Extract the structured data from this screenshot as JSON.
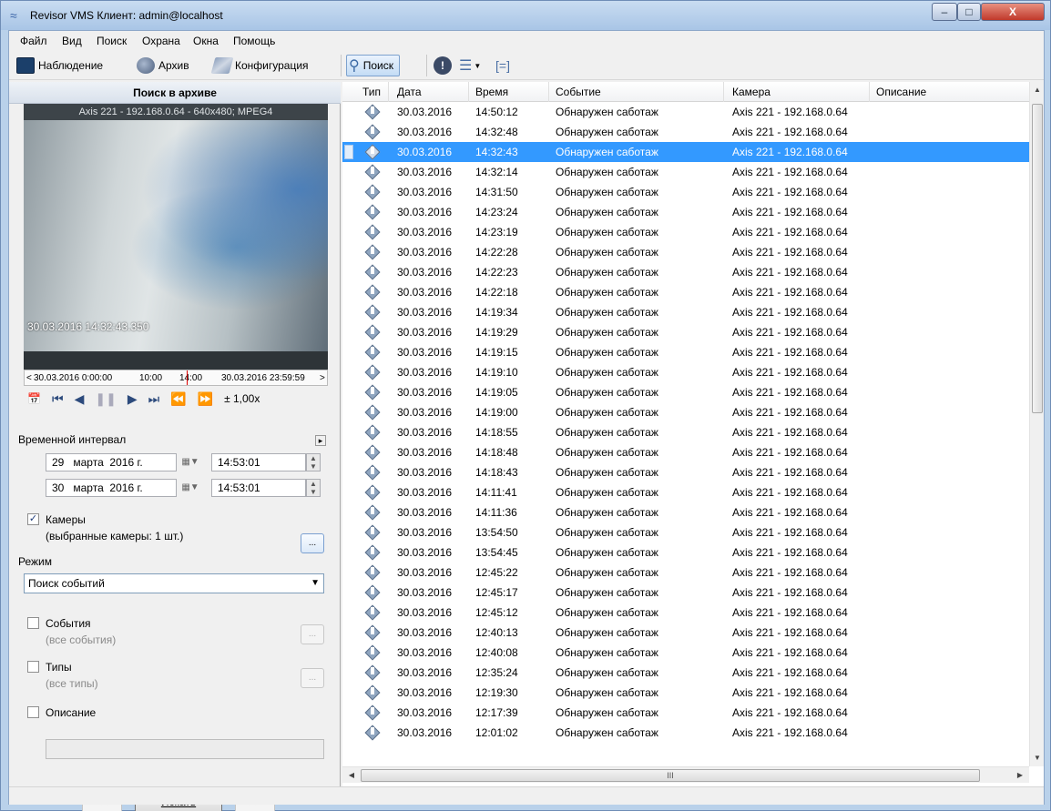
{
  "window": {
    "title": "Revisor VMS Клиент: admin@localhost",
    "buttons": {
      "minimize": "–",
      "maximize": "□",
      "close": "X"
    }
  },
  "menu": {
    "items": [
      "Файл",
      "Вид",
      "Поиск",
      "Охрана",
      "Окна",
      "Помощь"
    ]
  },
  "toolbar": {
    "observe": "Наблюдение",
    "archive": "Архив",
    "config": "Конфигурация",
    "search": "Поиск"
  },
  "left": {
    "header": "Поиск в архиве",
    "video_caption": "Axis 221 - 192.168.0.64 - 640x480; MPEG4",
    "video_timestamp": "30.03.2016 14:32:43.350",
    "timeline": {
      "start": "30.03.2016 0:00:00",
      "t1": "10:00",
      "t2": "14:00",
      "end": "30.03.2016 23:59:59"
    },
    "speed": "± 1,00x",
    "interval_label": "Временной интервал",
    "from": {
      "day": "29",
      "month": "марта",
      "year": "2016 г.",
      "time": "14:53:01"
    },
    "to": {
      "day": "30",
      "month": "марта",
      "year": "2016 г.",
      "time": "14:53:01"
    },
    "cameras_label": "Камеры",
    "cameras_sub": "(выбранные камеры: 1 шт.)",
    "mode_label": "Режим",
    "mode_value": "Поиск событий",
    "events_label": "События",
    "events_sub": "(все события)",
    "types_label": "Типы",
    "types_sub": "(все типы)",
    "desc_label": "Описание",
    "prev": "<<",
    "search": "Искать",
    "next": ">>"
  },
  "grid": {
    "headers": [
      "Тип",
      "Дата",
      "Время",
      "Событие",
      "Камера",
      "Описание"
    ],
    "selected_index": 2,
    "rows": [
      {
        "date": "30.03.2016",
        "time": "14:50:12",
        "event": "Обнаружен саботаж",
        "camera": "Axis 221 - 192.168.0.64"
      },
      {
        "date": "30.03.2016",
        "time": "14:32:48",
        "event": "Обнаружен саботаж",
        "camera": "Axis 221 - 192.168.0.64"
      },
      {
        "date": "30.03.2016",
        "time": "14:32:43",
        "event": "Обнаружен саботаж",
        "camera": "Axis 221 - 192.168.0.64"
      },
      {
        "date": "30.03.2016",
        "time": "14:32:14",
        "event": "Обнаружен саботаж",
        "camera": "Axis 221 - 192.168.0.64"
      },
      {
        "date": "30.03.2016",
        "time": "14:31:50",
        "event": "Обнаружен саботаж",
        "camera": "Axis 221 - 192.168.0.64"
      },
      {
        "date": "30.03.2016",
        "time": "14:23:24",
        "event": "Обнаружен саботаж",
        "camera": "Axis 221 - 192.168.0.64"
      },
      {
        "date": "30.03.2016",
        "time": "14:23:19",
        "event": "Обнаружен саботаж",
        "camera": "Axis 221 - 192.168.0.64"
      },
      {
        "date": "30.03.2016",
        "time": "14:22:28",
        "event": "Обнаружен саботаж",
        "camera": "Axis 221 - 192.168.0.64"
      },
      {
        "date": "30.03.2016",
        "time": "14:22:23",
        "event": "Обнаружен саботаж",
        "camera": "Axis 221 - 192.168.0.64"
      },
      {
        "date": "30.03.2016",
        "time": "14:22:18",
        "event": "Обнаружен саботаж",
        "camera": "Axis 221 - 192.168.0.64"
      },
      {
        "date": "30.03.2016",
        "time": "14:19:34",
        "event": "Обнаружен саботаж",
        "camera": "Axis 221 - 192.168.0.64"
      },
      {
        "date": "30.03.2016",
        "time": "14:19:29",
        "event": "Обнаружен саботаж",
        "camera": "Axis 221 - 192.168.0.64"
      },
      {
        "date": "30.03.2016",
        "time": "14:19:15",
        "event": "Обнаружен саботаж",
        "camera": "Axis 221 - 192.168.0.64"
      },
      {
        "date": "30.03.2016",
        "time": "14:19:10",
        "event": "Обнаружен саботаж",
        "camera": "Axis 221 - 192.168.0.64"
      },
      {
        "date": "30.03.2016",
        "time": "14:19:05",
        "event": "Обнаружен саботаж",
        "camera": "Axis 221 - 192.168.0.64"
      },
      {
        "date": "30.03.2016",
        "time": "14:19:00",
        "event": "Обнаружен саботаж",
        "camera": "Axis 221 - 192.168.0.64"
      },
      {
        "date": "30.03.2016",
        "time": "14:18:55",
        "event": "Обнаружен саботаж",
        "camera": "Axis 221 - 192.168.0.64"
      },
      {
        "date": "30.03.2016",
        "time": "14:18:48",
        "event": "Обнаружен саботаж",
        "camera": "Axis 221 - 192.168.0.64"
      },
      {
        "date": "30.03.2016",
        "time": "14:18:43",
        "event": "Обнаружен саботаж",
        "camera": "Axis 221 - 192.168.0.64"
      },
      {
        "date": "30.03.2016",
        "time": "14:11:41",
        "event": "Обнаружен саботаж",
        "camera": "Axis 221 - 192.168.0.64"
      },
      {
        "date": "30.03.2016",
        "time": "14:11:36",
        "event": "Обнаружен саботаж",
        "camera": "Axis 221 - 192.168.0.64"
      },
      {
        "date": "30.03.2016",
        "time": "13:54:50",
        "event": "Обнаружен саботаж",
        "camera": "Axis 221 - 192.168.0.64"
      },
      {
        "date": "30.03.2016",
        "time": "13:54:45",
        "event": "Обнаружен саботаж",
        "camera": "Axis 221 - 192.168.0.64"
      },
      {
        "date": "30.03.2016",
        "time": "12:45:22",
        "event": "Обнаружен саботаж",
        "camera": "Axis 221 - 192.168.0.64"
      },
      {
        "date": "30.03.2016",
        "time": "12:45:17",
        "event": "Обнаружен саботаж",
        "camera": "Axis 221 - 192.168.0.64"
      },
      {
        "date": "30.03.2016",
        "time": "12:45:12",
        "event": "Обнаружен саботаж",
        "camera": "Axis 221 - 192.168.0.64"
      },
      {
        "date": "30.03.2016",
        "time": "12:40:13",
        "event": "Обнаружен саботаж",
        "camera": "Axis 221 - 192.168.0.64"
      },
      {
        "date": "30.03.2016",
        "time": "12:40:08",
        "event": "Обнаружен саботаж",
        "camera": "Axis 221 - 192.168.0.64"
      },
      {
        "date": "30.03.2016",
        "time": "12:35:24",
        "event": "Обнаружен саботаж",
        "camera": "Axis 221 - 192.168.0.64"
      },
      {
        "date": "30.03.2016",
        "time": "12:19:30",
        "event": "Обнаружен саботаж",
        "camera": "Axis 221 - 192.168.0.64"
      },
      {
        "date": "30.03.2016",
        "time": "12:17:39",
        "event": "Обнаружен саботаж",
        "camera": "Axis 221 - 192.168.0.64"
      },
      {
        "date": "30.03.2016",
        "time": "12:01:02",
        "event": "Обнаружен саботаж",
        "camera": "Axis 221 - 192.168.0.64"
      }
    ],
    "hscroll_grip": "III"
  },
  "colors": {
    "selection": "#3399ff",
    "title_gradient_top": "#c9dcf1",
    "close_red": "#c0392b"
  }
}
